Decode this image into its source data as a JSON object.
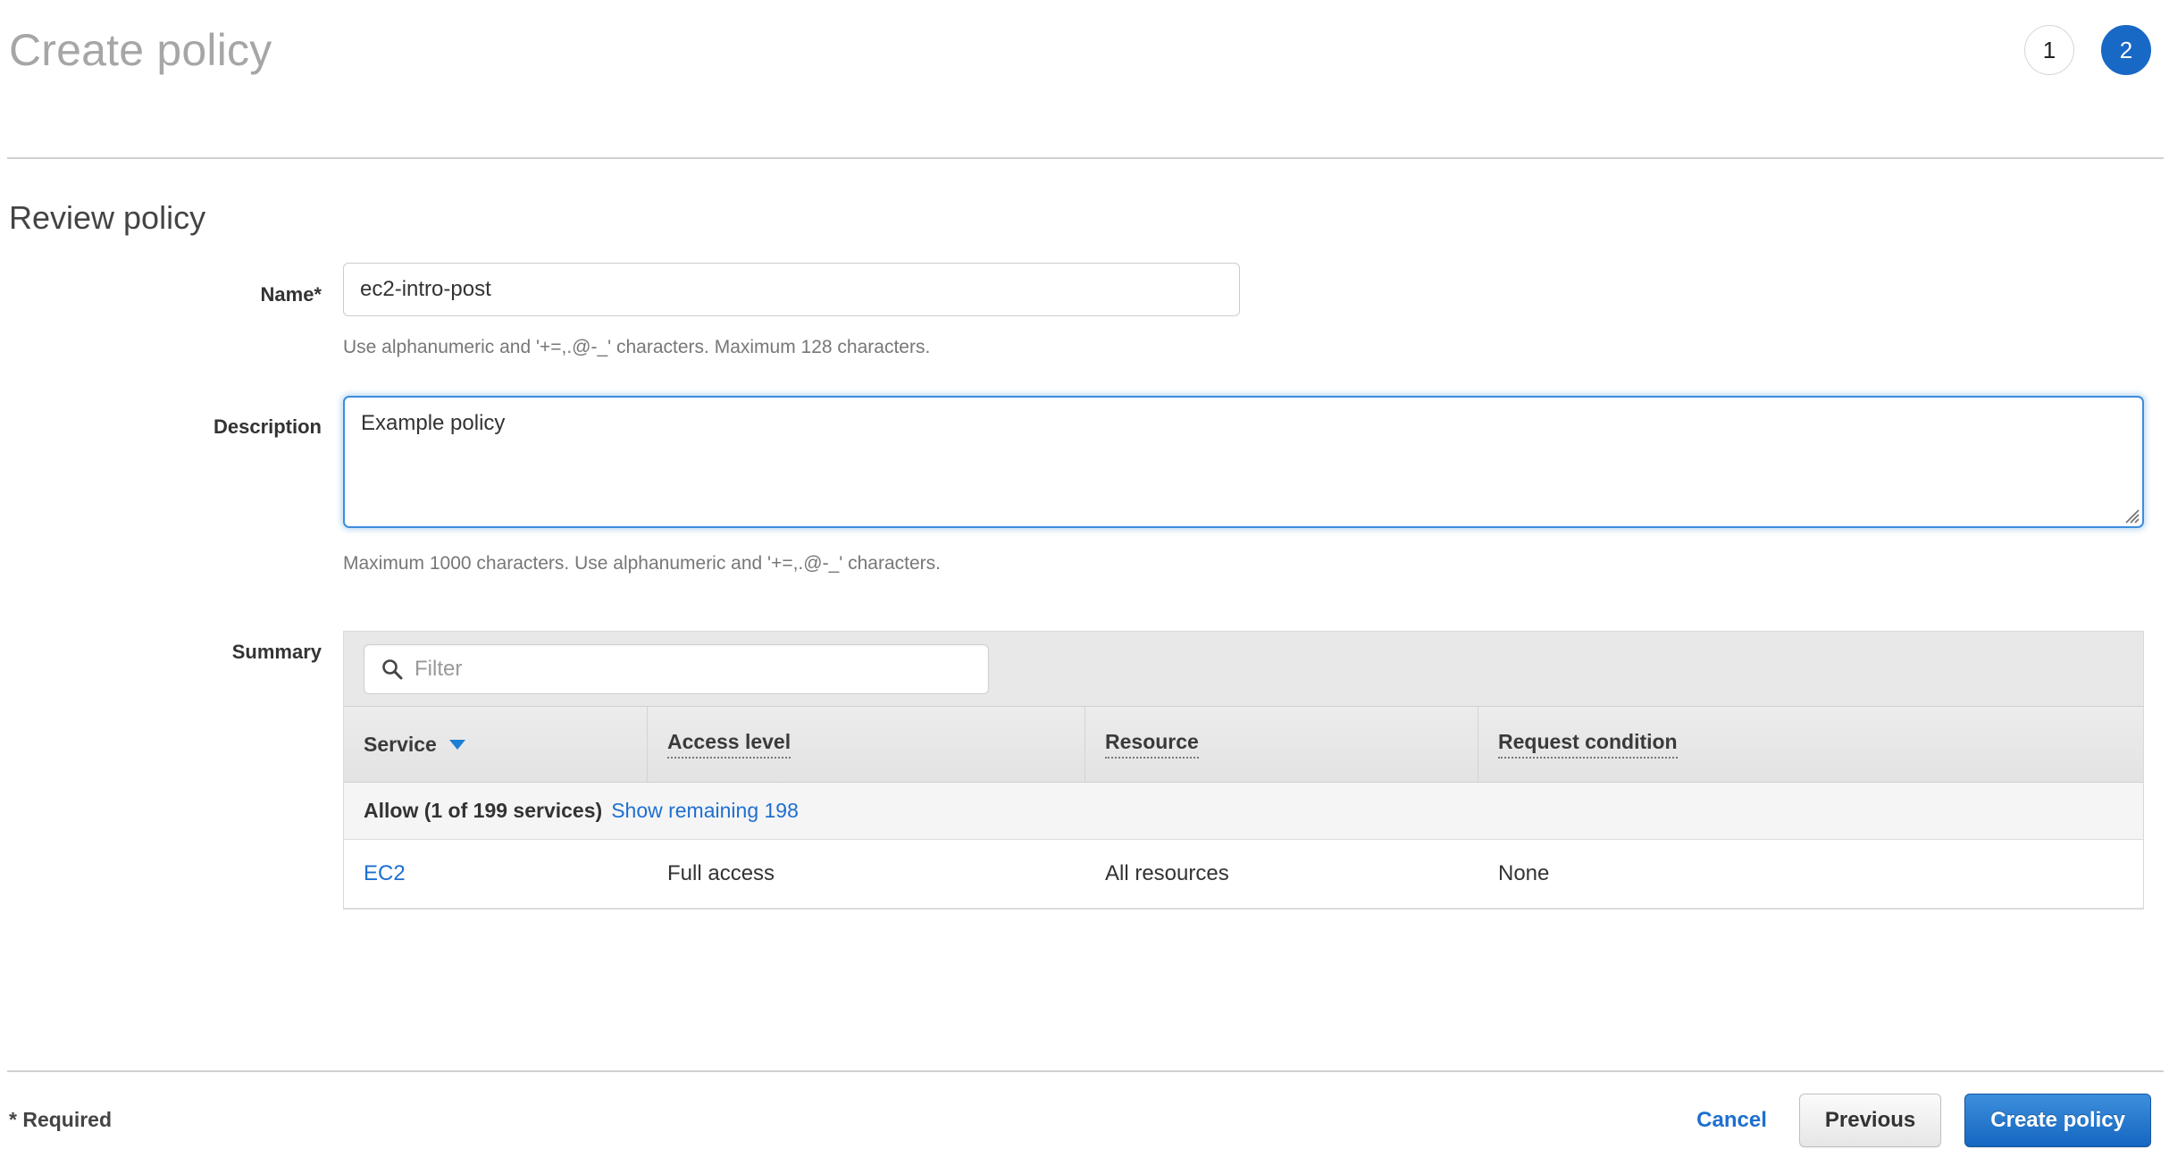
{
  "header": {
    "title": "Create policy",
    "steps": [
      {
        "label": "1",
        "state": "inactive"
      },
      {
        "label": "2",
        "state": "active"
      }
    ],
    "active_color": "#1868c6"
  },
  "section": {
    "title": "Review policy"
  },
  "form": {
    "name": {
      "label": "Name*",
      "value": "ec2-intro-post",
      "placeholder": "",
      "helper": "Use alphanumeric and '+=,.@-_' characters. Maximum 128 characters."
    },
    "description": {
      "label": "Description",
      "value": "Example policy",
      "placeholder": "",
      "helper": "Maximum 1000 characters. Use alphanumeric and '+=,.@-_' characters.",
      "focus_color": "#3c8dde"
    }
  },
  "summary": {
    "label": "Summary",
    "filter": {
      "placeholder": "Filter",
      "value": "",
      "icon": "search-icon"
    },
    "columns": [
      {
        "label": "Service",
        "sort": "descending",
        "dotted": false
      },
      {
        "label": "Access level",
        "sort": null,
        "dotted": true
      },
      {
        "label": "Resource",
        "sort": null,
        "dotted": true
      },
      {
        "label": "Request condition",
        "sort": null,
        "dotted": true
      }
    ],
    "group": {
      "title": "Allow (1 of 199 services)",
      "link": "Show remaining 198"
    },
    "rows": [
      {
        "service": "EC2",
        "access_level": "Full access",
        "resource": "All resources",
        "request_condition": "None"
      }
    ],
    "link_color": "#1d6fd0"
  },
  "footer": {
    "required_note": "* Required",
    "cancel": "Cancel",
    "previous": "Previous",
    "submit": "Create policy"
  }
}
